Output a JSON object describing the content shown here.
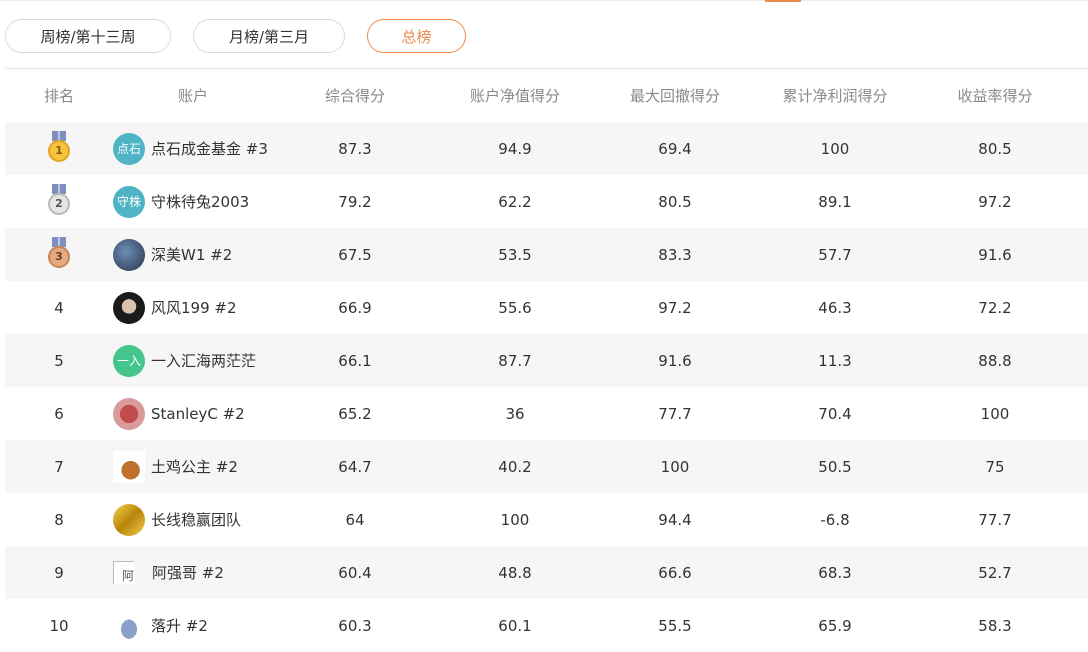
{
  "tabs": [
    {
      "label": "周榜/第十三周",
      "active": false
    },
    {
      "label": "月榜/第三月",
      "active": false
    },
    {
      "label": "总榜",
      "active": true
    }
  ],
  "headers": {
    "rank": "排名",
    "account": "账户",
    "score_total": "综合得分",
    "score_nav": "账户净值得分",
    "score_drawdown": "最大回撤得分",
    "score_profit": "累计净利润得分",
    "score_return": "收益率得分"
  },
  "rows": [
    {
      "rank": "1",
      "medal": "gold",
      "avatar_type": "text",
      "avatar_text": "点石",
      "avatar_color": "#4fb5c6",
      "name": "点石成金基金 #3",
      "s1": "87.3",
      "s2": "94.9",
      "s3": "69.4",
      "s4": "100",
      "s5": "80.5"
    },
    {
      "rank": "2",
      "medal": "silver",
      "avatar_type": "text",
      "avatar_text": "守株",
      "avatar_color": "#4fb5c6",
      "name": "守株待兔2003",
      "s1": "79.2",
      "s2": "62.2",
      "s3": "80.5",
      "s4": "89.1",
      "s5": "97.2"
    },
    {
      "rank": "3",
      "medal": "bronze",
      "avatar_type": "photo-landscape",
      "avatar_text": "",
      "name": "深美W1 #2",
      "s1": "67.5",
      "s2": "53.5",
      "s3": "83.3",
      "s4": "57.7",
      "s5": "91.6"
    },
    {
      "rank": "4",
      "medal": "",
      "avatar_type": "photo-portrait",
      "avatar_text": "",
      "name": "风风199 #2",
      "s1": "66.9",
      "s2": "55.6",
      "s3": "97.2",
      "s4": "46.3",
      "s5": "72.2"
    },
    {
      "rank": "5",
      "medal": "",
      "avatar_type": "text",
      "avatar_text": "一入",
      "avatar_color": "#45c58b",
      "name": "一入汇海两茫茫",
      "s1": "66.1",
      "s2": "87.7",
      "s3": "91.6",
      "s4": "11.3",
      "s5": "88.8"
    },
    {
      "rank": "6",
      "medal": "",
      "avatar_type": "photo-meat",
      "avatar_text": "",
      "name": "StanleyC #2",
      "s1": "65.2",
      "s2": "36",
      "s3": "77.7",
      "s4": "70.4",
      "s5": "100"
    },
    {
      "rank": "7",
      "medal": "",
      "avatar_type": "photo-chicken",
      "avatar_text": "",
      "name": "土鸡公主 #2",
      "s1": "64.7",
      "s2": "40.2",
      "s3": "100",
      "s4": "50.5",
      "s5": "75"
    },
    {
      "rank": "8",
      "medal": "",
      "avatar_type": "photo-gold",
      "avatar_text": "",
      "name": "长线稳赢团队",
      "s1": "64",
      "s2": "100",
      "s3": "94.4",
      "s4": "-6.8",
      "s5": "77.7"
    },
    {
      "rank": "9",
      "medal": "",
      "avatar_type": "broken",
      "avatar_text": "阿",
      "name": "阿强哥 #2",
      "s1": "60.4",
      "s2": "48.8",
      "s3": "66.6",
      "s4": "68.3",
      "s5": "52.7"
    },
    {
      "rank": "10",
      "medal": "",
      "avatar_type": "photo-figure",
      "avatar_text": "",
      "name": "落升 #2",
      "s1": "60.3",
      "s2": "60.1",
      "s3": "55.5",
      "s4": "65.9",
      "s5": "58.3"
    }
  ],
  "colors": {
    "accent": "#f08a4b",
    "row_shade": "#f6f6f6",
    "header_text": "#8a8a8a"
  }
}
